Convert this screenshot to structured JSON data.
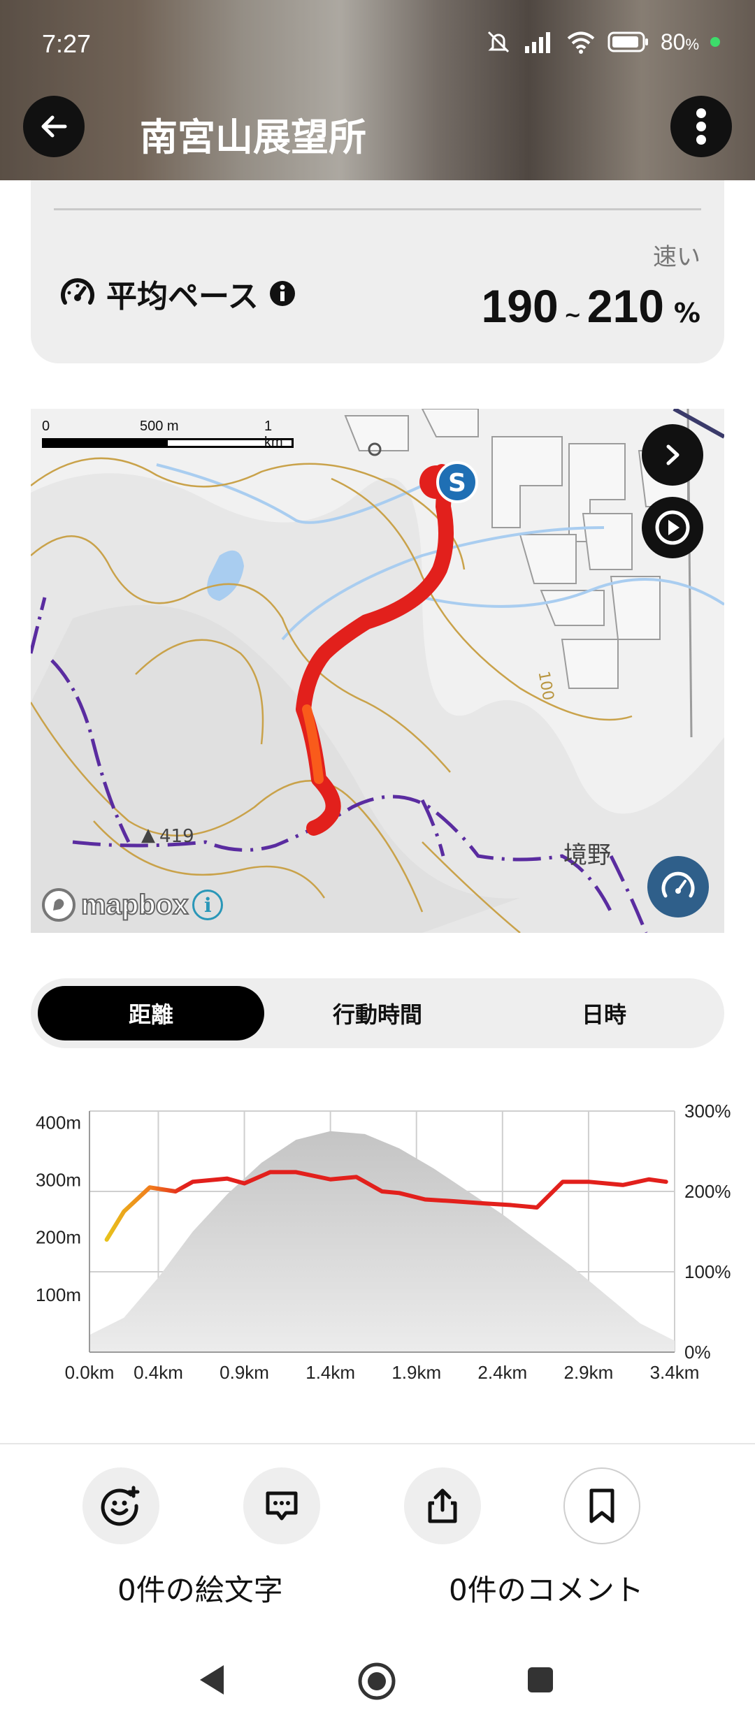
{
  "status_bar": {
    "time": "7:27",
    "battery": "80",
    "battery_unit": "%"
  },
  "header": {
    "title": "南宮山展望所"
  },
  "pace": {
    "label": "平均ペース",
    "speed_label": "速い",
    "range_low": "190",
    "range_sep": "~",
    "range_high": "210",
    "unit": "%"
  },
  "map": {
    "scale": {
      "start": "0",
      "mid": "500 m",
      "end": "1 km"
    },
    "elevation_label": "419",
    "place_label": "境野",
    "contour_label": "100",
    "start_marker": "S",
    "attribution": "mapbox",
    "info": "i",
    "colors": {
      "route": "#e2201c",
      "trail": "#5a2ca0",
      "contour": "#c9a24a",
      "water": "#a9cdf0"
    }
  },
  "tabs": [
    {
      "label": "距離",
      "active": true
    },
    {
      "label": "行動時間",
      "active": false
    },
    {
      "label": "日時",
      "active": false
    }
  ],
  "chart_data": {
    "type": "area",
    "title": "",
    "xlabel": "",
    "ylabel": "",
    "x_ticks": [
      "0.0km",
      "0.4km",
      "0.9km",
      "1.4km",
      "1.9km",
      "2.4km",
      "2.9km",
      "3.4km"
    ],
    "y_left_ticks": [
      "100m",
      "200m",
      "300m",
      "400m"
    ],
    "y_right_ticks": [
      "0%",
      "100%",
      "200%",
      "300%"
    ],
    "ylim_left": [
      0,
      420
    ],
    "ylim_right": [
      0,
      300
    ],
    "grid": true,
    "series": [
      {
        "values_km": [
          0.0,
          0.2,
          0.4,
          0.6,
          0.8,
          1.0,
          1.2,
          1.4,
          1.6,
          1.8,
          2.0,
          2.2,
          2.4,
          2.6,
          2.8,
          3.0,
          3.2,
          3.4
        ],
        "elevation_m": [
          30,
          60,
          130,
          210,
          275,
          330,
          370,
          385,
          380,
          355,
          320,
          280,
          240,
          195,
          150,
          100,
          50,
          20
        ]
      },
      {
        "values_km": [
          0.1,
          0.2,
          0.35,
          0.5,
          0.6,
          0.8,
          0.9,
          1.05,
          1.2,
          1.4,
          1.55,
          1.7,
          1.8,
          1.95,
          2.1,
          2.3,
          2.45,
          2.6,
          2.75,
          2.9,
          3.1,
          3.25,
          3.35
        ],
        "pace_pct": [
          140,
          175,
          205,
          200,
          212,
          216,
          210,
          224,
          224,
          215,
          218,
          200,
          198,
          190,
          188,
          185,
          183,
          180,
          212,
          212,
          208,
          215,
          212
        ]
      }
    ]
  },
  "footer": {
    "emoji_count": "0件の絵文字",
    "comment_count": "0件のコメント"
  }
}
